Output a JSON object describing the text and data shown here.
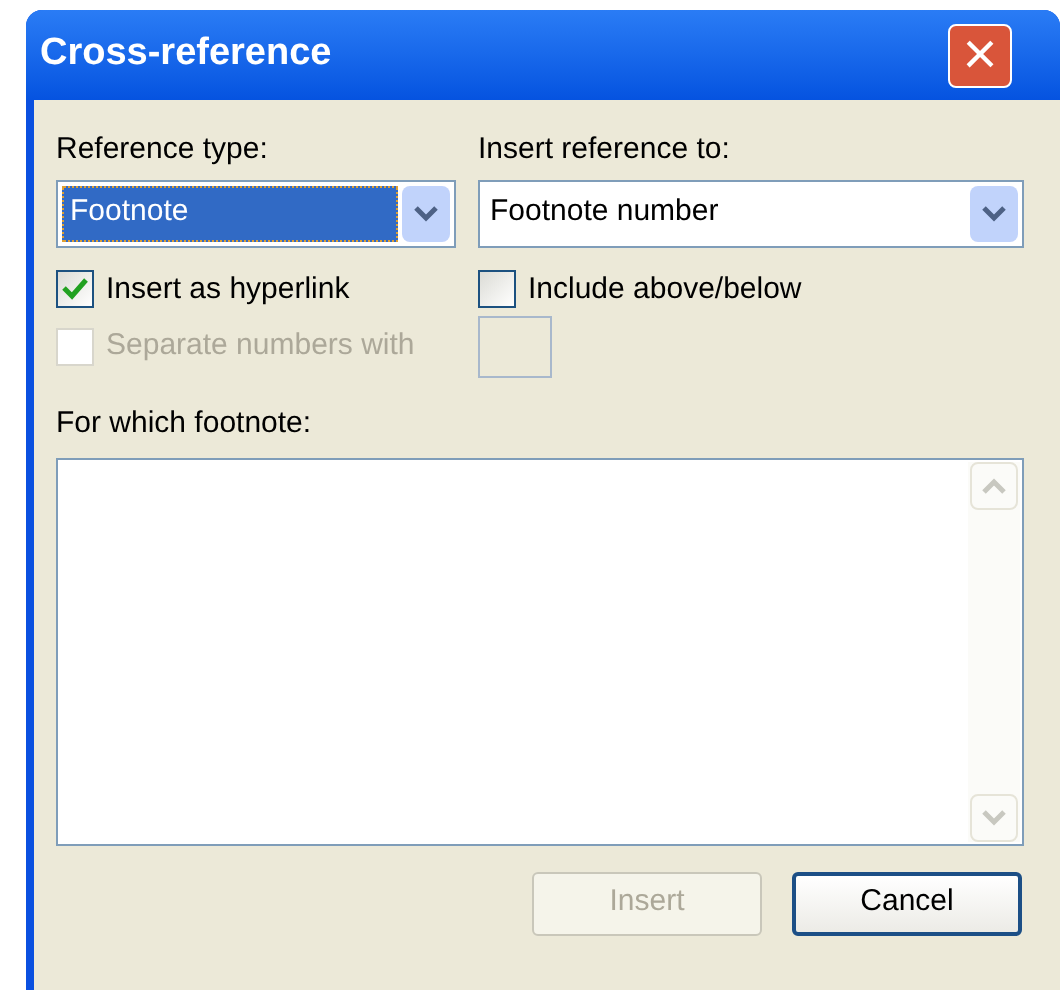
{
  "window": {
    "title": "Cross-reference",
    "close": "×"
  },
  "reference_type": {
    "label": "Reference type:",
    "value": "Footnote",
    "focused": true
  },
  "insert_reference_to": {
    "label": "Insert reference to:",
    "value": "Footnote number",
    "focused": false
  },
  "checkboxes": [
    {
      "label": "Insert as hyperlink",
      "checked": true,
      "disabled": false
    },
    {
      "label": "Include above/below",
      "checked": false,
      "disabled": false
    },
    {
      "label": "Separate numbers with",
      "checked": false,
      "disabled": true
    }
  ],
  "list": {
    "label": "For which footnote:"
  },
  "buttons": [
    {
      "label": "Insert",
      "disabled": true,
      "default": false
    },
    {
      "label": "Cancel",
      "disabled": false,
      "default": true
    }
  ]
}
